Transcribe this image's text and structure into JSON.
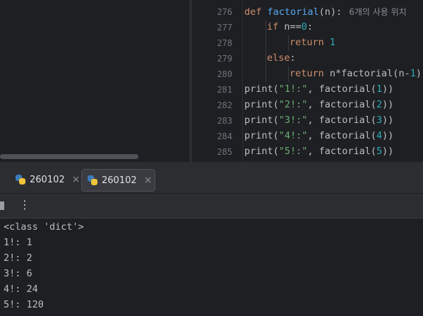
{
  "editor": {
    "lines": [
      {
        "num": "276",
        "tokens": [
          {
            "t": "def ",
            "c": "kw"
          },
          {
            "t": "factorial",
            "c": "fn"
          },
          {
            "t": "(n):",
            "c": ""
          }
        ],
        "hint": "6개의 사용 위치",
        "indent": 0
      },
      {
        "num": "277",
        "tokens": [
          {
            "t": "if ",
            "c": "kw"
          },
          {
            "t": "n==",
            "c": ""
          },
          {
            "t": "0",
            "c": "num"
          },
          {
            "t": ":",
            "c": ""
          }
        ],
        "indent": 1
      },
      {
        "num": "278",
        "tokens": [
          {
            "t": "return ",
            "c": "kw"
          },
          {
            "t": "1",
            "c": "num"
          }
        ],
        "indent": 2
      },
      {
        "num": "279",
        "tokens": [
          {
            "t": "else",
            "c": "kw"
          },
          {
            "t": ":",
            "c": ""
          }
        ],
        "indent": 1
      },
      {
        "num": "280",
        "tokens": [
          {
            "t": "return ",
            "c": "kw"
          },
          {
            "t": "n*factorial(n-",
            "c": ""
          },
          {
            "t": "1",
            "c": "num"
          },
          {
            "t": ")",
            "c": ""
          }
        ],
        "indent": 2
      },
      {
        "num": "281",
        "tokens": [
          {
            "t": "print",
            "c": ""
          },
          {
            "t": "(",
            "c": ""
          },
          {
            "t": "\"1!:\"",
            "c": "str"
          },
          {
            "t": ", factorial(",
            "c": ""
          },
          {
            "t": "1",
            "c": "num"
          },
          {
            "t": "))",
            "c": ""
          }
        ],
        "indent": 0
      },
      {
        "num": "282",
        "tokens": [
          {
            "t": "print",
            "c": ""
          },
          {
            "t": "(",
            "c": ""
          },
          {
            "t": "\"2!:\"",
            "c": "str"
          },
          {
            "t": ", factorial(",
            "c": ""
          },
          {
            "t": "2",
            "c": "num"
          },
          {
            "t": "))",
            "c": ""
          }
        ],
        "indent": 0
      },
      {
        "num": "283",
        "tokens": [
          {
            "t": "print",
            "c": ""
          },
          {
            "t": "(",
            "c": ""
          },
          {
            "t": "\"3!:\"",
            "c": "str"
          },
          {
            "t": ", factorial(",
            "c": ""
          },
          {
            "t": "3",
            "c": "num"
          },
          {
            "t": "))",
            "c": ""
          }
        ],
        "indent": 0
      },
      {
        "num": "284",
        "tokens": [
          {
            "t": "print",
            "c": ""
          },
          {
            "t": "(",
            "c": ""
          },
          {
            "t": "\"4!:\"",
            "c": "str"
          },
          {
            "t": ", factorial(",
            "c": ""
          },
          {
            "t": "4",
            "c": "num"
          },
          {
            "t": "))",
            "c": ""
          }
        ],
        "indent": 0
      },
      {
        "num": "285",
        "tokens": [
          {
            "t": "print",
            "c": ""
          },
          {
            "t": "(",
            "c": ""
          },
          {
            "t": "\"5!:\"",
            "c": "str"
          },
          {
            "t": ", factorial(",
            "c": ""
          },
          {
            "t": "5",
            "c": "num"
          },
          {
            "t": "))",
            "c": ""
          }
        ],
        "indent": 0
      }
    ]
  },
  "tabs": [
    {
      "label": "260102",
      "icon": "python-icon",
      "active": false,
      "close": "×"
    },
    {
      "label": "260102",
      "icon": "python-icon",
      "active": true,
      "close": "×"
    }
  ],
  "toolbar": {
    "menu_icon": "⋮"
  },
  "console": {
    "lines": [
      "<class 'dict'>",
      "1!: 1",
      "2!: 2",
      "3!: 6",
      "4!: 24",
      "5!: 120"
    ]
  }
}
